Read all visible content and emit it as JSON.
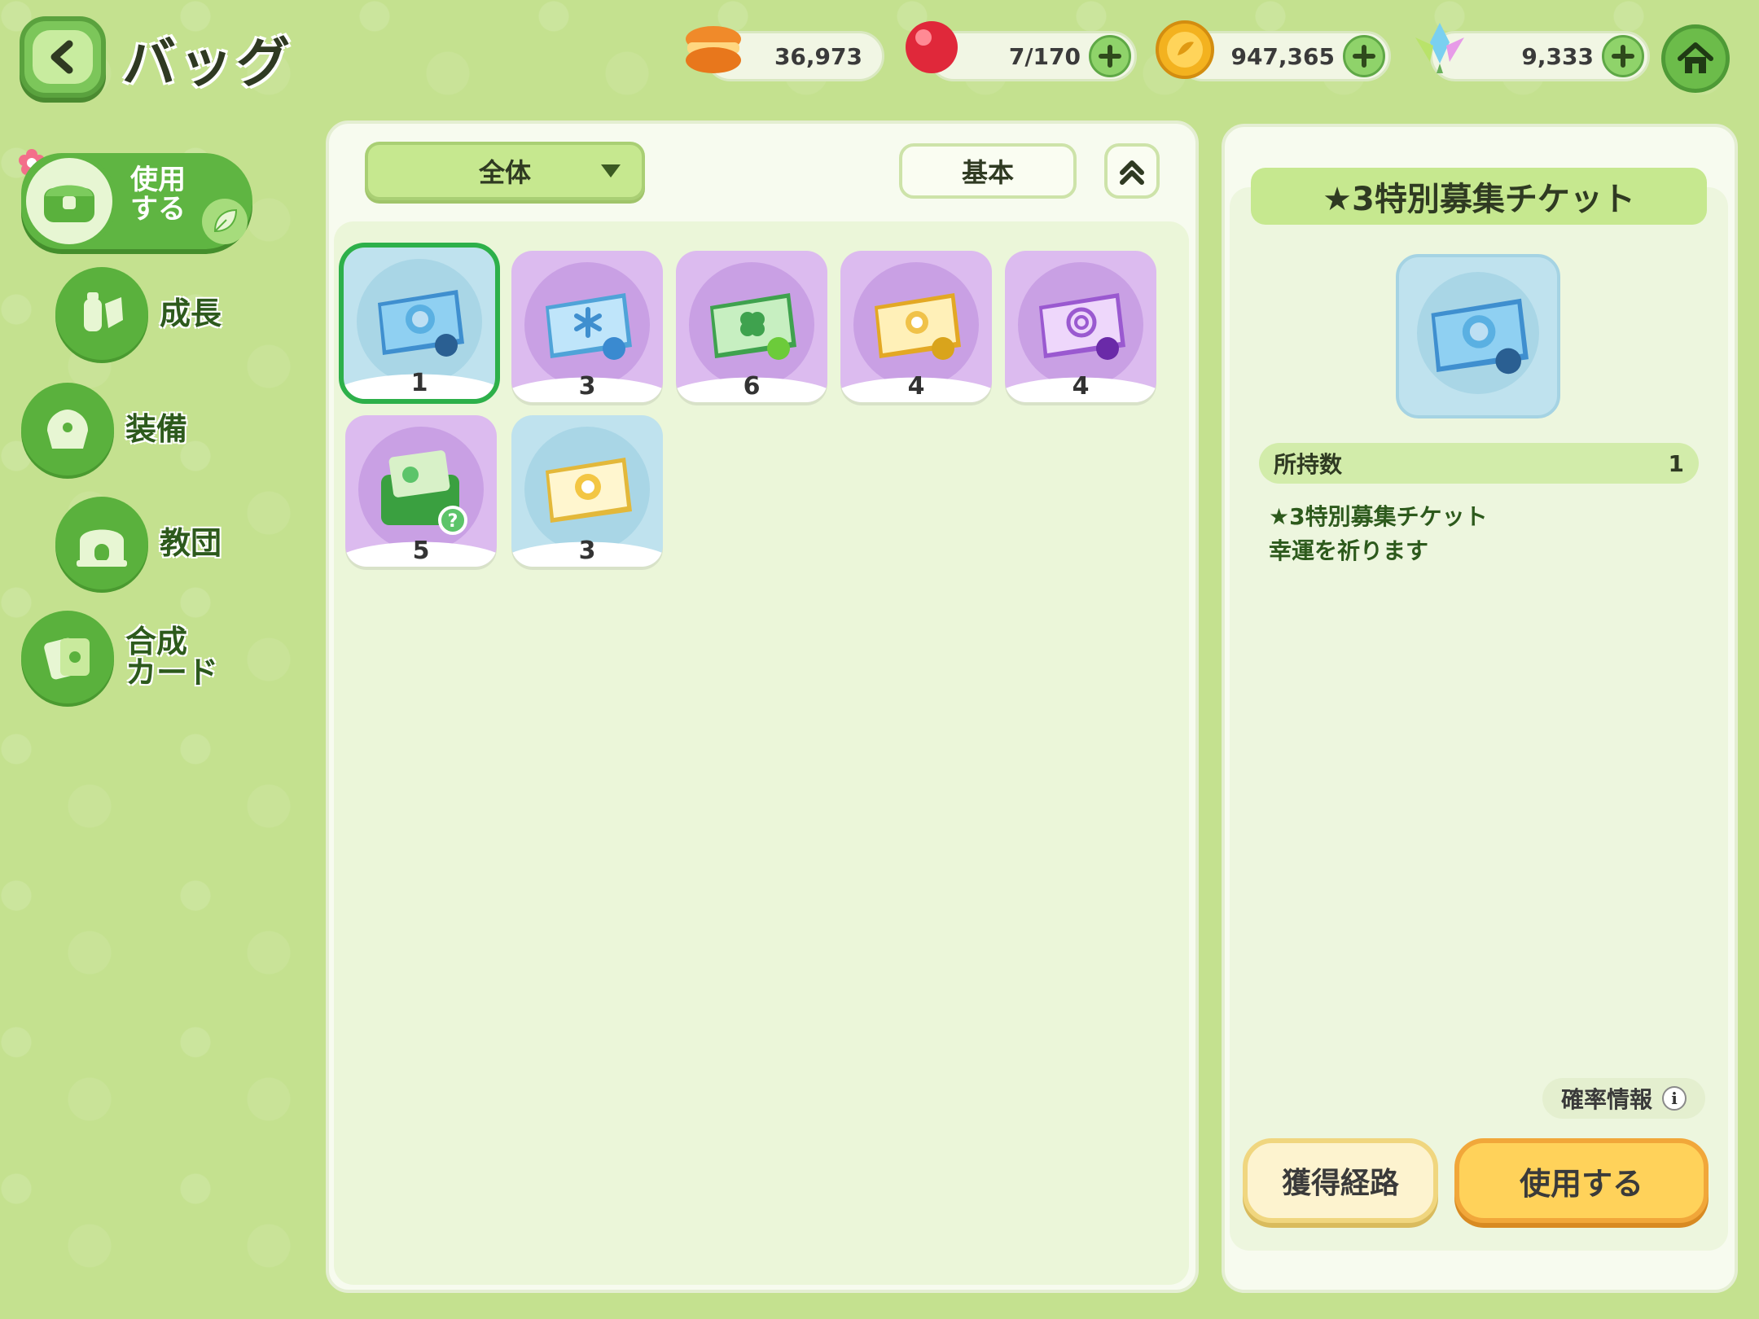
{
  "header": {
    "title": "バッグ",
    "back_icon": "chevron-left-icon",
    "home_icon": "home-icon"
  },
  "currencies": [
    {
      "name": "macaron",
      "icon": "macaron-icon",
      "value": "36,973",
      "has_plus": false
    },
    {
      "name": "candy",
      "icon": "candy-icon",
      "value": "7/170",
      "has_plus": true
    },
    {
      "name": "coin",
      "icon": "coin-icon",
      "value": "947,365",
      "has_plus": true
    },
    {
      "name": "crystal",
      "icon": "crystal-icon",
      "value": "9,333",
      "has_plus": true
    }
  ],
  "nav": {
    "active": {
      "label_line1": "使用",
      "label_line2": "する",
      "icon": "chest-icon"
    },
    "items": [
      {
        "label": "成長",
        "icon": "potion-icon"
      },
      {
        "label": "装備",
        "icon": "equipment-icon"
      },
      {
        "label": "教団",
        "icon": "temple-icon"
      },
      {
        "label_line1": "合成",
        "label_line2": "カード",
        "icon": "card-icon"
      }
    ]
  },
  "inventory": {
    "filter_label": "全体",
    "sort_label": "基本",
    "items": [
      {
        "type": "blue",
        "ticket": "star-ticket",
        "count": "1",
        "selected": true,
        "color": "#4aa6d8"
      },
      {
        "type": "purple",
        "ticket": "snowflake-ticket",
        "count": "3",
        "selected": false,
        "color": "#6ab8e8"
      },
      {
        "type": "purple",
        "ticket": "clover-ticket",
        "count": "6",
        "selected": false,
        "color": "#5cc46a"
      },
      {
        "type": "purple",
        "ticket": "sun-ticket",
        "count": "4",
        "selected": false,
        "color": "#f0c24a"
      },
      {
        "type": "purple",
        "ticket": "spiral-ticket",
        "count": "4",
        "selected": false,
        "color": "#b77de0"
      },
      {
        "type": "purple",
        "ticket": "green-card-case",
        "count": "5",
        "selected": false,
        "color": "#4aa84a"
      },
      {
        "type": "blue",
        "ticket": "gold-sun-ticket",
        "count": "3",
        "selected": false,
        "color": "#f0c24a"
      }
    ]
  },
  "detail": {
    "title": "★3特別募集チケット",
    "own_label": "所持数",
    "own_value": "1",
    "desc_line1": "★3特別募集チケット",
    "desc_line2": "幸運を祈ります",
    "rate_label": "確率情報",
    "source_button": "獲得経路",
    "use_button": "使用する"
  }
}
